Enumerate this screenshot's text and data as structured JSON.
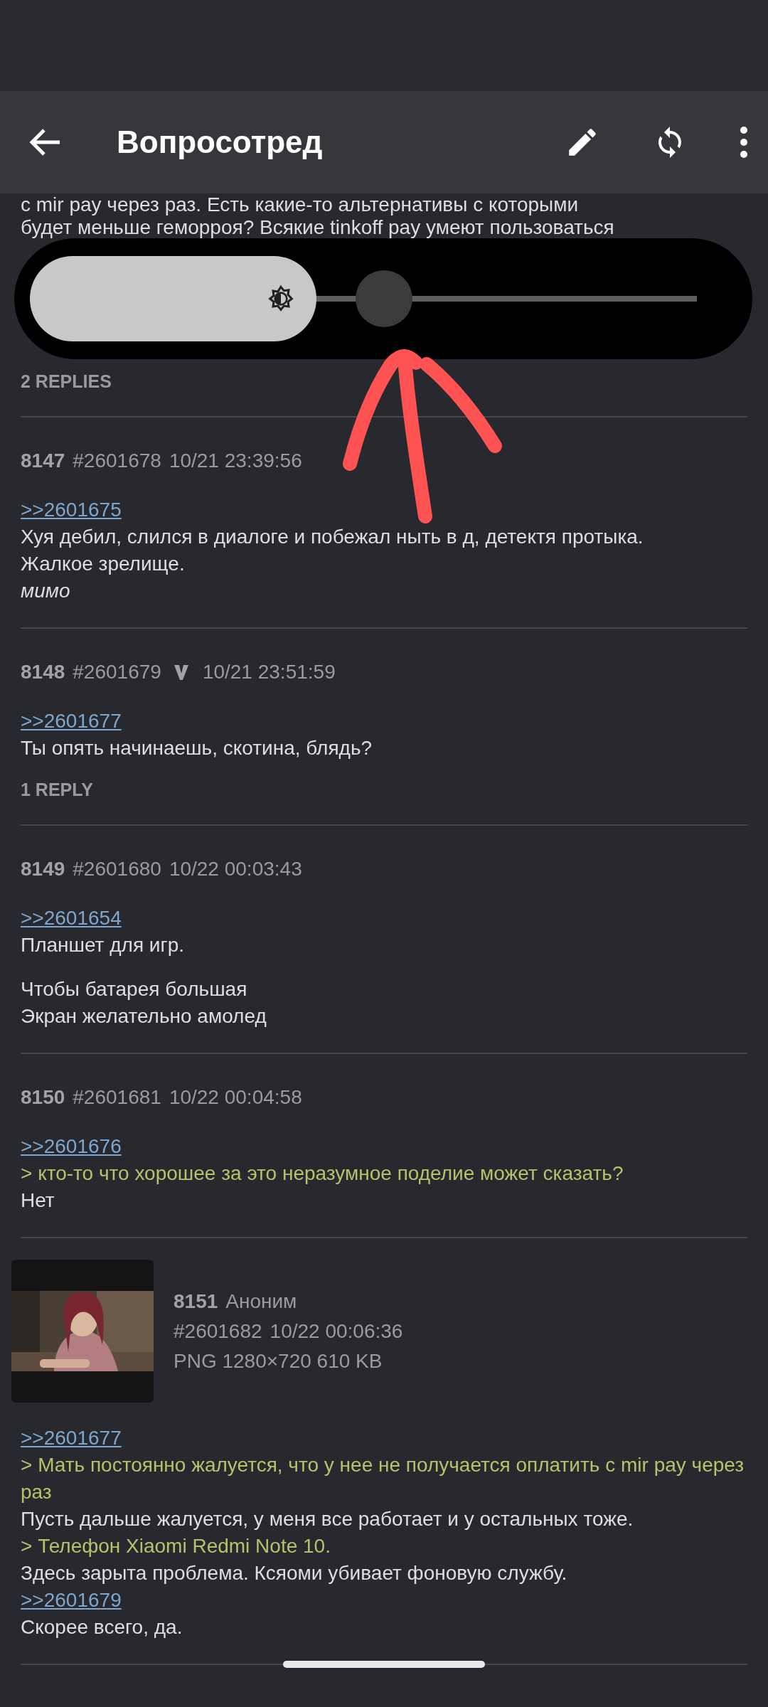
{
  "app_bar": {
    "title": "Вопросотред"
  },
  "brightness": {
    "level": 0.43
  },
  "posts": [
    {
      "kind": "partial",
      "paragraphs": [
        [
          {
            "kind": "text",
            "text": "с mir pay через раз. Есть какие-то альтернативы с которыми"
          },
          {
            "kind": "text",
            "text": "будет меньше геморроя? Всякие tinkoff pay умеют пользоваться"
          }
        ]
      ],
      "replies": "2 REPLIES"
    },
    {
      "kind": "post",
      "number": "8147",
      "id": "#2601678",
      "date": "10/21 23:39:56",
      "flag_icon": false,
      "paragraphs": [
        [
          {
            "kind": "link",
            "text": ">>2601675"
          },
          {
            "kind": "text",
            "text": "Хуя дебил, слился в диалоге и побежал ныть в д, детектя протыка."
          },
          {
            "kind": "text",
            "text": "Жалкое зрелище."
          },
          {
            "kind": "italic",
            "text": "мимо"
          }
        ]
      ]
    },
    {
      "kind": "post",
      "number": "8148",
      "id": "#2601679",
      "date": "10/21 23:51:59",
      "flag_icon": true,
      "paragraphs": [
        [
          {
            "kind": "link",
            "text": ">>2601677"
          },
          {
            "kind": "text",
            "text": "Ты опять начинаешь, скотина, блядь?"
          }
        ]
      ],
      "replies": "1 REPLY"
    },
    {
      "kind": "post",
      "number": "8149",
      "id": "#2601680",
      "date": "10/22 00:03:43",
      "flag_icon": false,
      "paragraphs": [
        [
          {
            "kind": "link",
            "text": ">>2601654"
          },
          {
            "kind": "text",
            "text": "Планшет для игр."
          }
        ],
        [
          {
            "kind": "text",
            "text": "Чтобы батарея большая"
          },
          {
            "kind": "text",
            "text": "Экран желательно амолед"
          }
        ]
      ]
    },
    {
      "kind": "post",
      "number": "8150",
      "id": "#2601681",
      "date": "10/22 00:04:58",
      "flag_icon": false,
      "paragraphs": [
        [
          {
            "kind": "link",
            "text": ">>2601676"
          },
          {
            "kind": "quote",
            "text": "> кто-то что хорошее за это неразумное поделие может сказать?"
          },
          {
            "kind": "text",
            "text": "Нет"
          }
        ]
      ]
    },
    {
      "number": "8151",
      "author": "Аноним",
      "id": "#2601682",
      "date": "10/22 00:06:36",
      "file": "PNG 1280×720 610 KB",
      "flag_icon": false,
      "paragraphs": [
        [
          {
            "kind": "link",
            "text": ">>2601677"
          },
          {
            "kind": "quote",
            "text": "> Мать постоянно жалуется, что у нее не получается оплатить с mir pay через раз"
          },
          {
            "kind": "text",
            "text": "Пусть дальше жалуется, у меня все работает и у остальных тоже."
          },
          {
            "kind": "quote",
            "text": "> Телефон Xiaomi Redmi Note 10."
          },
          {
            "kind": "text",
            "text": "Здесь зарыта проблема. Ксяоми убивает фоновую службу."
          },
          {
            "kind": "link",
            "text": ">>2601679"
          },
          {
            "kind": "text",
            "text": "Скорее всего, да."
          }
        ]
      ]
    }
  ]
}
